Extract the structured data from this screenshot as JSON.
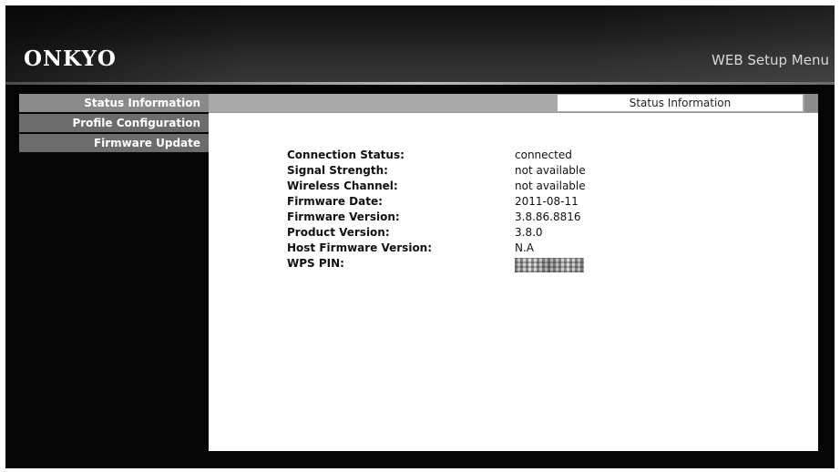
{
  "header": {
    "logo": "ONKYO",
    "title": "WEB Setup Menu"
  },
  "sidebar": {
    "items": [
      {
        "label": "Status Information",
        "active": true
      },
      {
        "label": "Profile Configuration",
        "active": false
      },
      {
        "label": "Firmware Update",
        "active": false
      }
    ]
  },
  "main": {
    "tab": "Status Information",
    "fields": [
      {
        "label": "Connection Status:",
        "value": "connected"
      },
      {
        "label": "Signal Strength:",
        "value": "not available"
      },
      {
        "label": "Wireless Channel:",
        "value": "not available"
      },
      {
        "label": "Firmware Date:",
        "value": "2011-08-11"
      },
      {
        "label": "Firmware Version:",
        "value": "3.8.86.8816"
      },
      {
        "label": "Product Version:",
        "value": "3.8.0"
      },
      {
        "label": "Host Firmware Version:",
        "value": "N.A"
      },
      {
        "label": "WPS PIN:",
        "value": ""
      }
    ]
  },
  "colors": {
    "background": "#050505",
    "nav_item": "#6c6c6c",
    "tab_bar": "#a9a9a9",
    "content": "#ffffff"
  }
}
